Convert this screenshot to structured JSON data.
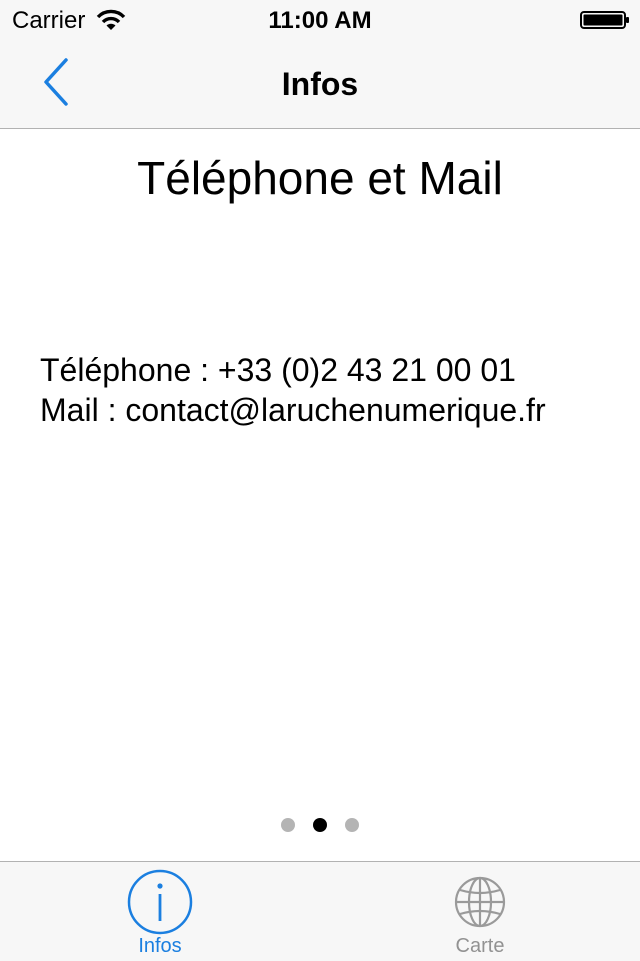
{
  "status_bar": {
    "carrier": "Carrier",
    "time": "11:00 AM"
  },
  "nav_bar": {
    "title": "Infos",
    "back_icon": "chevron-left-icon"
  },
  "content": {
    "title": "Téléphone et Mail",
    "phone_line": "Téléphone : +33 (0)2 43 21 00 01",
    "mail_line": "Mail : contact@laruchenumerique.fr"
  },
  "page_control": {
    "page_count": 3,
    "current_page": 2
  },
  "tab_bar": {
    "tabs": [
      {
        "label": "Infos",
        "icon": "info-icon",
        "selected": true
      },
      {
        "label": "Carte",
        "icon": "globe-icon",
        "selected": false
      }
    ]
  },
  "colors": {
    "accent": "#1b7fe0",
    "inactive": "#929292",
    "bar_background": "#f7f7f7"
  }
}
